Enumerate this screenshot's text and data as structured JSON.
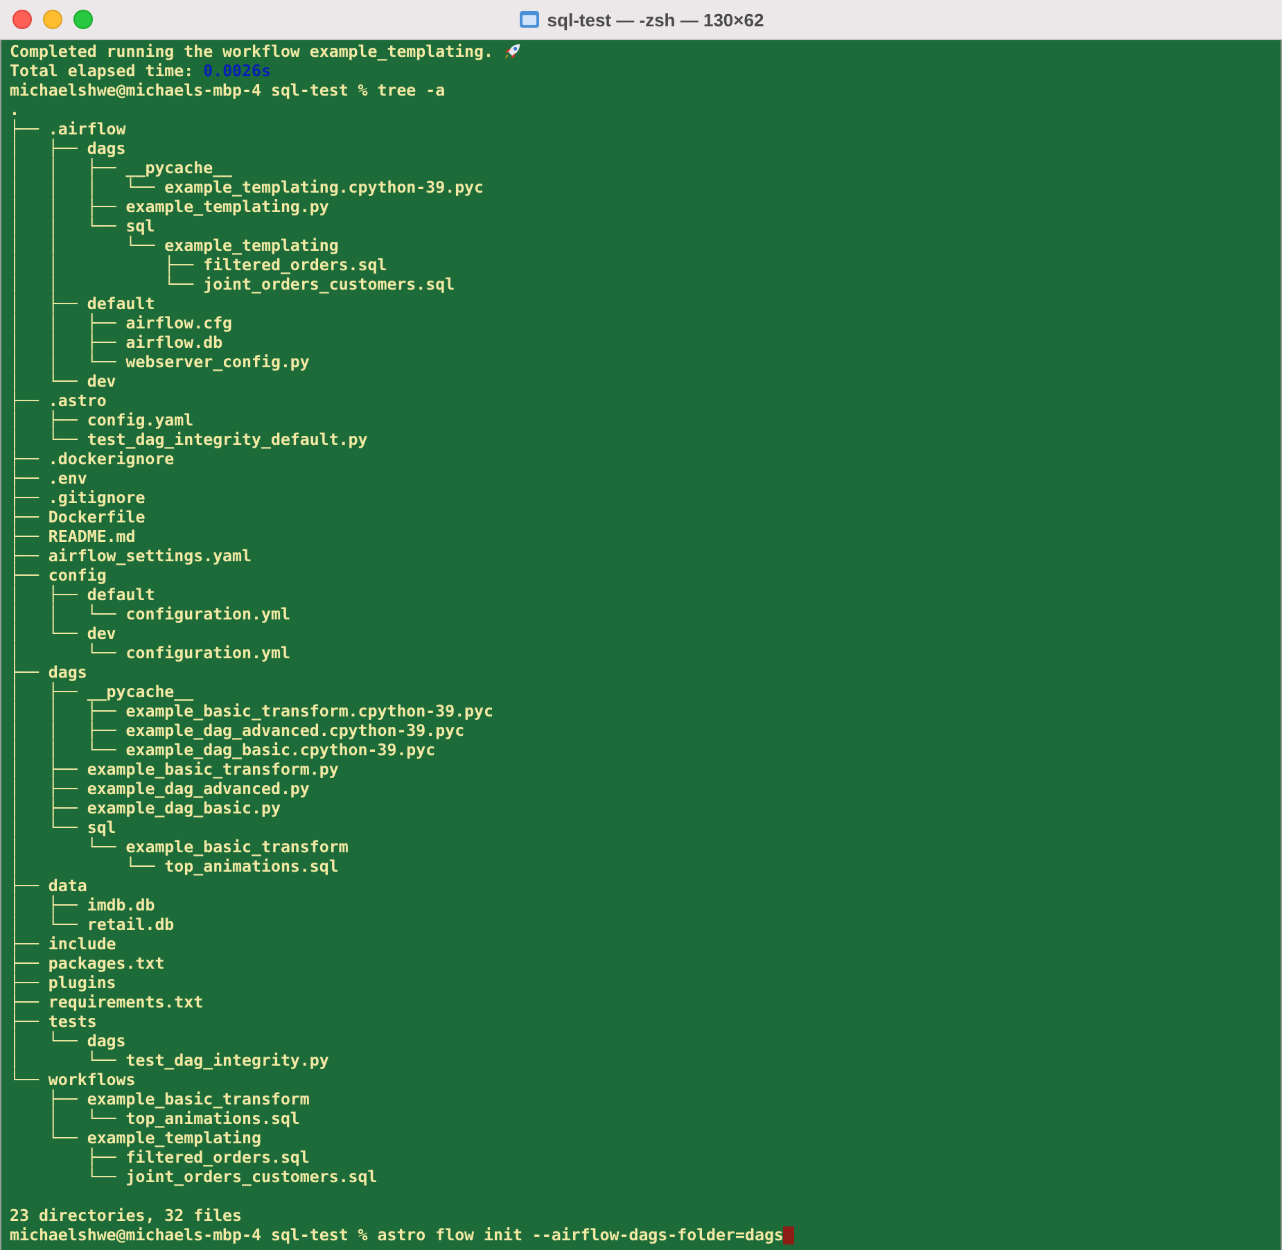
{
  "window": {
    "title": "sql-test — -zsh — 130×62"
  },
  "terminal": {
    "lines": [
      {
        "kind": "text",
        "segments": [
          {
            "kind": "plain",
            "text": "Completed running the workflow example_templating. "
          }
        ],
        "rocket": true
      },
      {
        "kind": "text",
        "segments": [
          {
            "kind": "plain",
            "text": "Total elapsed time: "
          },
          {
            "kind": "number",
            "text": "0.0026s"
          }
        ]
      },
      {
        "kind": "text",
        "segments": [
          {
            "kind": "plain",
            "text": "michaelshwe@michaels-mbp-4 sql-test % tree -a"
          }
        ]
      },
      {
        "kind": "text",
        "segments": [
          {
            "kind": "plain",
            "text": "."
          }
        ]
      },
      {
        "kind": "text",
        "segments": [
          {
            "kind": "plain",
            "text": "├── .airflow"
          }
        ]
      },
      {
        "kind": "text",
        "segments": [
          {
            "kind": "plain",
            "text": "│   ├── dags"
          }
        ]
      },
      {
        "kind": "text",
        "segments": [
          {
            "kind": "plain",
            "text": "│   │   ├── __pycache__"
          }
        ]
      },
      {
        "kind": "text",
        "segments": [
          {
            "kind": "plain",
            "text": "│   │   │   └── example_templating.cpython-39.pyc"
          }
        ]
      },
      {
        "kind": "text",
        "segments": [
          {
            "kind": "plain",
            "text": "│   │   ├── example_templating.py"
          }
        ]
      },
      {
        "kind": "text",
        "segments": [
          {
            "kind": "plain",
            "text": "│   │   └── sql"
          }
        ]
      },
      {
        "kind": "text",
        "segments": [
          {
            "kind": "plain",
            "text": "│   │       └── example_templating"
          }
        ]
      },
      {
        "kind": "text",
        "segments": [
          {
            "kind": "plain",
            "text": "│   │           ├── filtered_orders.sql"
          }
        ]
      },
      {
        "kind": "text",
        "segments": [
          {
            "kind": "plain",
            "text": "│   │           └── joint_orders_customers.sql"
          }
        ]
      },
      {
        "kind": "text",
        "segments": [
          {
            "kind": "plain",
            "text": "│   ├── default"
          }
        ]
      },
      {
        "kind": "text",
        "segments": [
          {
            "kind": "plain",
            "text": "│   │   ├── airflow.cfg"
          }
        ]
      },
      {
        "kind": "text",
        "segments": [
          {
            "kind": "plain",
            "text": "│   │   ├── airflow.db"
          }
        ]
      },
      {
        "kind": "text",
        "segments": [
          {
            "kind": "plain",
            "text": "│   │   └── webserver_config.py"
          }
        ]
      },
      {
        "kind": "text",
        "segments": [
          {
            "kind": "plain",
            "text": "│   └── dev"
          }
        ]
      },
      {
        "kind": "text",
        "segments": [
          {
            "kind": "plain",
            "text": "├── .astro"
          }
        ]
      },
      {
        "kind": "text",
        "segments": [
          {
            "kind": "plain",
            "text": "│   ├── config.yaml"
          }
        ]
      },
      {
        "kind": "text",
        "segments": [
          {
            "kind": "plain",
            "text": "│   └── test_dag_integrity_default.py"
          }
        ]
      },
      {
        "kind": "text",
        "segments": [
          {
            "kind": "plain",
            "text": "├── .dockerignore"
          }
        ]
      },
      {
        "kind": "text",
        "segments": [
          {
            "kind": "plain",
            "text": "├── .env"
          }
        ]
      },
      {
        "kind": "text",
        "segments": [
          {
            "kind": "plain",
            "text": "├── .gitignore"
          }
        ]
      },
      {
        "kind": "text",
        "segments": [
          {
            "kind": "plain",
            "text": "├── Dockerfile"
          }
        ]
      },
      {
        "kind": "text",
        "segments": [
          {
            "kind": "plain",
            "text": "├── README.md"
          }
        ]
      },
      {
        "kind": "text",
        "segments": [
          {
            "kind": "plain",
            "text": "├── airflow_settings.yaml"
          }
        ]
      },
      {
        "kind": "text",
        "segments": [
          {
            "kind": "plain",
            "text": "├── config"
          }
        ]
      },
      {
        "kind": "text",
        "segments": [
          {
            "kind": "plain",
            "text": "│   ├── default"
          }
        ]
      },
      {
        "kind": "text",
        "segments": [
          {
            "kind": "plain",
            "text": "│   │   └── configuration.yml"
          }
        ]
      },
      {
        "kind": "text",
        "segments": [
          {
            "kind": "plain",
            "text": "│   └── dev"
          }
        ]
      },
      {
        "kind": "text",
        "segments": [
          {
            "kind": "plain",
            "text": "│       └── configuration.yml"
          }
        ]
      },
      {
        "kind": "text",
        "segments": [
          {
            "kind": "plain",
            "text": "├── dags"
          }
        ]
      },
      {
        "kind": "text",
        "segments": [
          {
            "kind": "plain",
            "text": "│   ├── __pycache__"
          }
        ]
      },
      {
        "kind": "text",
        "segments": [
          {
            "kind": "plain",
            "text": "│   │   ├── example_basic_transform.cpython-39.pyc"
          }
        ]
      },
      {
        "kind": "text",
        "segments": [
          {
            "kind": "plain",
            "text": "│   │   ├── example_dag_advanced.cpython-39.pyc"
          }
        ]
      },
      {
        "kind": "text",
        "segments": [
          {
            "kind": "plain",
            "text": "│   │   └── example_dag_basic.cpython-39.pyc"
          }
        ]
      },
      {
        "kind": "text",
        "segments": [
          {
            "kind": "plain",
            "text": "│   ├── example_basic_transform.py"
          }
        ]
      },
      {
        "kind": "text",
        "segments": [
          {
            "kind": "plain",
            "text": "│   ├── example_dag_advanced.py"
          }
        ]
      },
      {
        "kind": "text",
        "segments": [
          {
            "kind": "plain",
            "text": "│   ├── example_dag_basic.py"
          }
        ]
      },
      {
        "kind": "text",
        "segments": [
          {
            "kind": "plain",
            "text": "│   └── sql"
          }
        ]
      },
      {
        "kind": "text",
        "segments": [
          {
            "kind": "plain",
            "text": "│       └── example_basic_transform"
          }
        ]
      },
      {
        "kind": "text",
        "segments": [
          {
            "kind": "plain",
            "text": "│           └── top_animations.sql"
          }
        ]
      },
      {
        "kind": "text",
        "segments": [
          {
            "kind": "plain",
            "text": "├── data"
          }
        ]
      },
      {
        "kind": "text",
        "segments": [
          {
            "kind": "plain",
            "text": "│   ├── imdb.db"
          }
        ]
      },
      {
        "kind": "text",
        "segments": [
          {
            "kind": "plain",
            "text": "│   └── retail.db"
          }
        ]
      },
      {
        "kind": "text",
        "segments": [
          {
            "kind": "plain",
            "text": "├── include"
          }
        ]
      },
      {
        "kind": "text",
        "segments": [
          {
            "kind": "plain",
            "text": "├── packages.txt"
          }
        ]
      },
      {
        "kind": "text",
        "segments": [
          {
            "kind": "plain",
            "text": "├── plugins"
          }
        ]
      },
      {
        "kind": "text",
        "segments": [
          {
            "kind": "plain",
            "text": "├── requirements.txt"
          }
        ]
      },
      {
        "kind": "text",
        "segments": [
          {
            "kind": "plain",
            "text": "├── tests"
          }
        ]
      },
      {
        "kind": "text",
        "segments": [
          {
            "kind": "plain",
            "text": "│   └── dags"
          }
        ]
      },
      {
        "kind": "text",
        "segments": [
          {
            "kind": "plain",
            "text": "│       └── test_dag_integrity.py"
          }
        ]
      },
      {
        "kind": "text",
        "segments": [
          {
            "kind": "plain",
            "text": "└── workflows"
          }
        ]
      },
      {
        "kind": "text",
        "segments": [
          {
            "kind": "plain",
            "text": "    ├── example_basic_transform"
          }
        ]
      },
      {
        "kind": "text",
        "segments": [
          {
            "kind": "plain",
            "text": "    │   └── top_animations.sql"
          }
        ]
      },
      {
        "kind": "text",
        "segments": [
          {
            "kind": "plain",
            "text": "    └── example_templating"
          }
        ]
      },
      {
        "kind": "text",
        "segments": [
          {
            "kind": "plain",
            "text": "        ├── filtered_orders.sql"
          }
        ]
      },
      {
        "kind": "text",
        "segments": [
          {
            "kind": "plain",
            "text": "        └── joint_orders_customers.sql"
          }
        ]
      },
      {
        "kind": "blank"
      },
      {
        "kind": "text",
        "segments": [
          {
            "kind": "plain",
            "text": "23 directories, 32 files"
          }
        ]
      },
      {
        "kind": "text",
        "segments": [
          {
            "kind": "plain",
            "text": "michaelshwe@michaels-mbp-4 sql-test % astro flow init --airflow-dags-folder=dags"
          }
        ],
        "cursor": true
      }
    ]
  }
}
